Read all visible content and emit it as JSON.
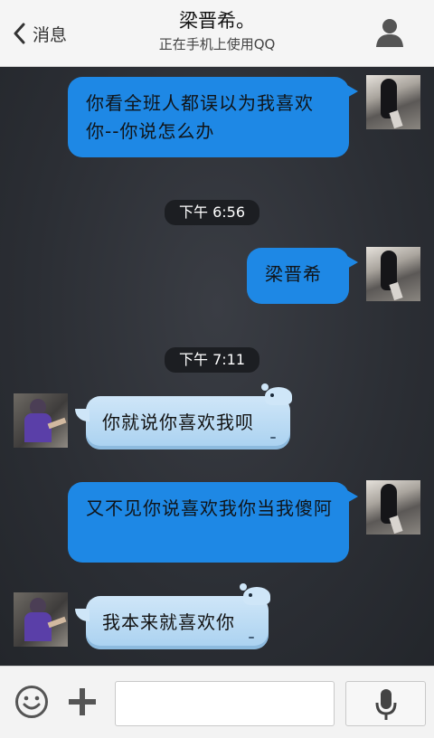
{
  "header": {
    "back_label": "消息",
    "contact_name": "梁晋希。",
    "status": "正在手机上使用QQ"
  },
  "messages": [
    {
      "side": "out",
      "text": "你看全班人都误以为我喜欢你--你说怎么办"
    },
    {
      "type": "time",
      "text": "下午 6:56"
    },
    {
      "side": "out",
      "text": "梁晋希"
    },
    {
      "type": "time",
      "text": "下午 7:11"
    },
    {
      "side": "in",
      "text": "你就说你喜欢我呗"
    },
    {
      "side": "out",
      "text": "又不见你说喜欢我你当我傻阿"
    },
    {
      "side": "in",
      "text": "我本来就喜欢你"
    }
  ],
  "input": {
    "value": "",
    "placeholder": ""
  },
  "colors": {
    "outgoing_bubble": "#1e88e5",
    "incoming_bubble": "#bcdcf4",
    "header_bg": "#f5f5f5",
    "chat_bg": "#2a2d33"
  }
}
